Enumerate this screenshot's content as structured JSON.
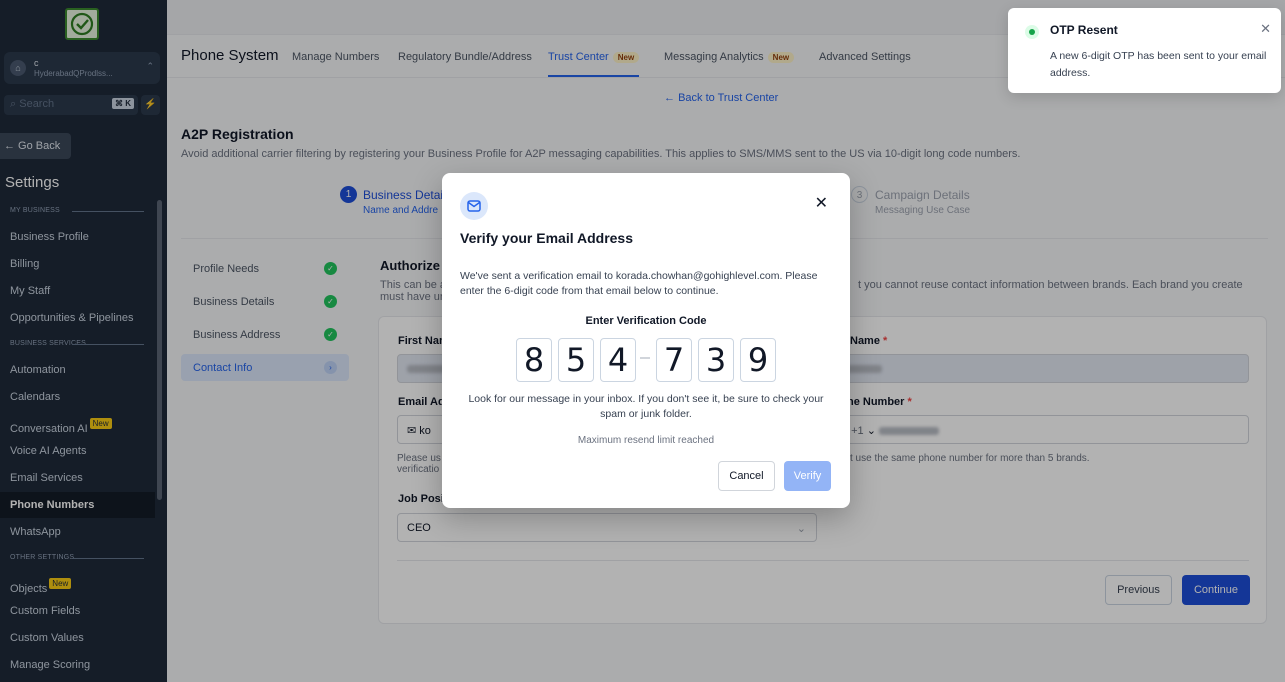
{
  "sidebar": {
    "account_name": "c",
    "account_location": "HyderabadQProdlss...",
    "search_placeholder": "Search",
    "search_shortcut": "⌘ K",
    "go_back": "← Go Back",
    "title": "Settings",
    "sections": [
      "MY BUSINESS",
      "BUSINESS SERVICES",
      "OTHER SETTINGS"
    ],
    "items": [
      {
        "label": "Business Profile"
      },
      {
        "label": "Billing"
      },
      {
        "label": "My Staff"
      },
      {
        "label": "Opportunities & Pipelines"
      },
      {
        "label": "Automation"
      },
      {
        "label": "Calendars"
      },
      {
        "label": "Conversation AI",
        "badge": "New"
      },
      {
        "label": "Voice AI Agents"
      },
      {
        "label": "Email Services"
      },
      {
        "label": "Phone Numbers"
      },
      {
        "label": "WhatsApp"
      },
      {
        "label": "Objects",
        "badge": "New"
      },
      {
        "label": "Custom Fields"
      },
      {
        "label": "Custom Values"
      },
      {
        "label": "Manage Scoring"
      }
    ]
  },
  "header": {
    "title": "Phone System",
    "tabs": [
      {
        "label": "Manage Numbers"
      },
      {
        "label": "Regulatory Bundle/Address"
      },
      {
        "label": "Trust Center",
        "badge": "New"
      },
      {
        "label": "Messaging Analytics",
        "badge": "New"
      },
      {
        "label": "Advanced Settings"
      }
    ]
  },
  "main": {
    "back_link": "Back to Trust Center",
    "heading": "A2P Registration",
    "subheading": "Avoid additional carrier filtering by registering your Business Profile for A2P messaging capabilities. This applies to SMS/MMS sent to the US via 10-digit long code numbers.",
    "steps": [
      {
        "num": "1",
        "title": "Business Detai",
        "sub": "Name and Addre"
      },
      {
        "num": "3",
        "title": "Campaign Details",
        "sub": "Messaging Use Case"
      }
    ],
    "left_nav": [
      "Profile Needs",
      "Business Details",
      "Business Address",
      "Contact Info"
    ],
    "auth_title": "Authorize",
    "auth_desc_a": "This can be a",
    "auth_desc_b": "must have ur",
    "auth_desc_right": "t you cannot reuse contact information between brands. Each brand you create",
    "form": {
      "first_name_label": "First Nam",
      "last_name_label": "Name",
      "email_label": "Email Add",
      "email_value": "ko",
      "phone_label": "ne Number",
      "phone_code": "+1",
      "note_a": "Please us",
      "note_b": "verificatio",
      "note_right": "t use the same phone number for more than 5 brands.",
      "job_label": "Job Posit",
      "job_value": "CEO"
    },
    "prev_button": "Previous",
    "continue_button": "Continue"
  },
  "modal": {
    "title": "Verify your Email Address",
    "description": "We've sent a verification email to korada.chowhan@gohighlevel.com. Please enter the 6-digit code from that email below to continue.",
    "code_label": "Enter Verification Code",
    "digits": [
      "8",
      "5",
      "4",
      "7",
      "3",
      "9"
    ],
    "help_text": "Look for our message in your inbox. If you don't see it, be sure to check your spam or junk folder.",
    "limit_text": "Maximum resend limit reached",
    "cancel_button": "Cancel",
    "verify_button": "Verify"
  },
  "toast": {
    "title": "OTP Resent",
    "message": "A new 6-digit OTP has been sent to your email address."
  },
  "colors": {
    "primary": "#1d4ed8",
    "sidebar_bg": "#1f2a3a",
    "success": "#22c55e",
    "badge": "#facc15"
  }
}
